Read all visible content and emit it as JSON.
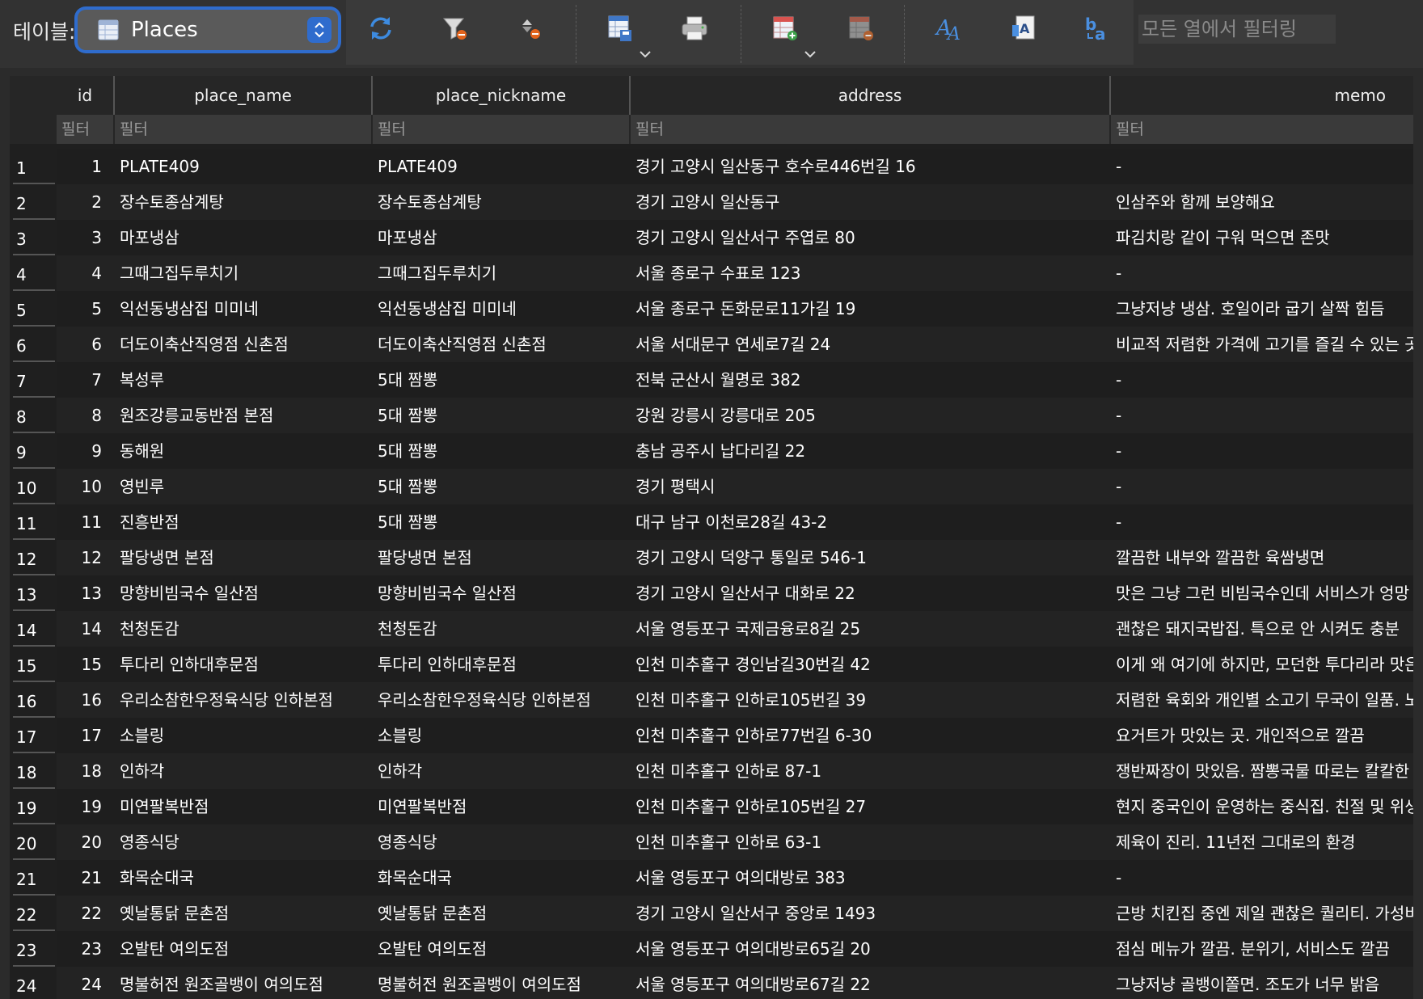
{
  "toolbar": {
    "table_label": "테이블:",
    "selected_table": "Places",
    "filter_all_placeholder": "모든 열에서 필터링",
    "accent_color": "#2f6ccd"
  },
  "grid": {
    "columns": [
      {
        "key": "id",
        "label": "id"
      },
      {
        "key": "place_name",
        "label": "place_name"
      },
      {
        "key": "place_nickname",
        "label": "place_nickname"
      },
      {
        "key": "address",
        "label": "address"
      },
      {
        "key": "memo",
        "label": "memo"
      }
    ],
    "filter_placeholder": "필터",
    "rows": [
      {
        "rownum": "1",
        "id": "1",
        "place_name": "PLATE409",
        "place_nickname": "PLATE409",
        "address": "경기 고양시 일산동구 호수로446번길 16",
        "memo": "-"
      },
      {
        "rownum": "2",
        "id": "2",
        "place_name": "장수토종삼계탕",
        "place_nickname": "장수토종삼계탕",
        "address": "경기 고양시 일산동구",
        "memo": "인삼주와 함께 보양해요"
      },
      {
        "rownum": "3",
        "id": "3",
        "place_name": "마포냉삼",
        "place_nickname": "마포냉삼",
        "address": "경기 고양시 일산서구 주엽로 80",
        "memo": "파김치랑 같이 구워 먹으면 존맛"
      },
      {
        "rownum": "4",
        "id": "4",
        "place_name": "그때그집두루치기",
        "place_nickname": "그때그집두루치기",
        "address": "서울 종로구 수표로 123",
        "memo": "-"
      },
      {
        "rownum": "5",
        "id": "5",
        "place_name": "익선동냉삼집 미미네",
        "place_nickname": "익선동냉삼집 미미네",
        "address": "서울 종로구 돈화문로11가길 19",
        "memo": "그냥저냥 냉삼. 호일이라 굽기 살짝 힘듬"
      },
      {
        "rownum": "6",
        "id": "6",
        "place_name": "더도이축산직영점 신촌점",
        "place_nickname": "더도이축산직영점 신촌점",
        "address": "서울 서대문구 연세로7길 24",
        "memo": "비교적 저렴한 가격에 고기를 즐길 수 있는 곳"
      },
      {
        "rownum": "7",
        "id": "7",
        "place_name": "복성루",
        "place_nickname": "5대 짬뽕",
        "address": "전북 군산시 월명로 382",
        "memo": "-"
      },
      {
        "rownum": "8",
        "id": "8",
        "place_name": "원조강릉교동반점 본점",
        "place_nickname": "5대 짬뽕",
        "address": "강원 강릉시 강릉대로 205",
        "memo": "-"
      },
      {
        "rownum": "9",
        "id": "9",
        "place_name": "동해원",
        "place_nickname": "5대 짬뽕",
        "address": "충남 공주시 납다리길 22",
        "memo": "-"
      },
      {
        "rownum": "10",
        "id": "10",
        "place_name": "영빈루",
        "place_nickname": "5대 짬뽕",
        "address": "경기 평택시",
        "memo": "-"
      },
      {
        "rownum": "11",
        "id": "11",
        "place_name": "진흥반점",
        "place_nickname": "5대 짬뽕",
        "address": "대구 남구 이천로28길 43-2",
        "memo": "-"
      },
      {
        "rownum": "12",
        "id": "12",
        "place_name": "팔당냉면 본점",
        "place_nickname": "팔당냉면 본점",
        "address": "경기 고양시 덕양구 통일로 546-1",
        "memo": "깔끔한 내부와 깔끔한 육쌈냉면"
      },
      {
        "rownum": "13",
        "id": "13",
        "place_name": "망향비빔국수 일산점",
        "place_nickname": "망향비빔국수 일산점",
        "address": "경기 고양시 일산서구 대화로 22",
        "memo": "맛은 그냥 그런 비빔국수인데 서비스가 엉망"
      },
      {
        "rownum": "14",
        "id": "14",
        "place_name": "천청돈감",
        "place_nickname": "천청돈감",
        "address": "서울 영등포구 국제금융로8길 25",
        "memo": "괜찮은 돼지국밥집. 특으로 안 시켜도 충분"
      },
      {
        "rownum": "15",
        "id": "15",
        "place_name": "투다리 인하대후문점",
        "place_nickname": "투다리 인하대후문점",
        "address": "인천 미추홀구 경인남길30번길 42",
        "memo": "이게 왜 여기에 하지만, 모던한 투다리라 맛은"
      },
      {
        "rownum": "16",
        "id": "16",
        "place_name": "우리소참한우정육식당 인하본점",
        "place_nickname": "우리소참한우정육식당 인하본점",
        "address": "인천 미추홀구 인하로105번길 39",
        "memo": "저렴한 육회와 개인별 소고기 무국이 일품. 노"
      },
      {
        "rownum": "17",
        "id": "17",
        "place_name": "소블링",
        "place_nickname": "소블링",
        "address": "인천 미추홀구 인하로77번길 6-30",
        "memo": "요거트가 맛있는 곳. 개인적으로 깔끔"
      },
      {
        "rownum": "18",
        "id": "18",
        "place_name": "인하각",
        "place_nickname": "인하각",
        "address": "인천 미추홀구 인하로 87-1",
        "memo": "쟁반짜장이 맛있음. 짬뽕국물 따로는 칼칼한 맛"
      },
      {
        "rownum": "19",
        "id": "19",
        "place_name": "미연팔복반점",
        "place_nickname": "미연팔복반점",
        "address": "인천 미추홀구 인하로105번길 27",
        "memo": "현지 중국인이 운영하는 중식집. 친절 및 위생"
      },
      {
        "rownum": "20",
        "id": "20",
        "place_name": "영종식당",
        "place_nickname": "영종식당",
        "address": "인천 미추홀구 인하로 63-1",
        "memo": "제육이 진리. 11년전 그대로의 환경"
      },
      {
        "rownum": "21",
        "id": "21",
        "place_name": "화목순대국",
        "place_nickname": "화목순대국",
        "address": "서울 영등포구 여의대방로 383",
        "memo": "-"
      },
      {
        "rownum": "22",
        "id": "22",
        "place_name": "옛날통닭 문촌점",
        "place_nickname": "옛날통닭 문촌점",
        "address": "경기 고양시 일산서구 중앙로 1493",
        "memo": "근방 치킨집 중엔 제일 괜찮은 퀄리티. 가성비"
      },
      {
        "rownum": "23",
        "id": "23",
        "place_name": "오발탄 여의도점",
        "place_nickname": "오발탄 여의도점",
        "address": "서울 영등포구 여의대방로65길 20",
        "memo": "점심 메뉴가 깔끔. 분위기, 서비스도 깔끔"
      },
      {
        "rownum": "24",
        "id": "24",
        "place_name": "명불허전 원조골뱅이 여의도점",
        "place_nickname": "명불허전 원조골뱅이 여의도점",
        "address": "서울 영등포구 여의대방로67길 22",
        "memo": "그냥저냥 골뱅이쫄면. 조도가 너무 밝음"
      }
    ]
  }
}
